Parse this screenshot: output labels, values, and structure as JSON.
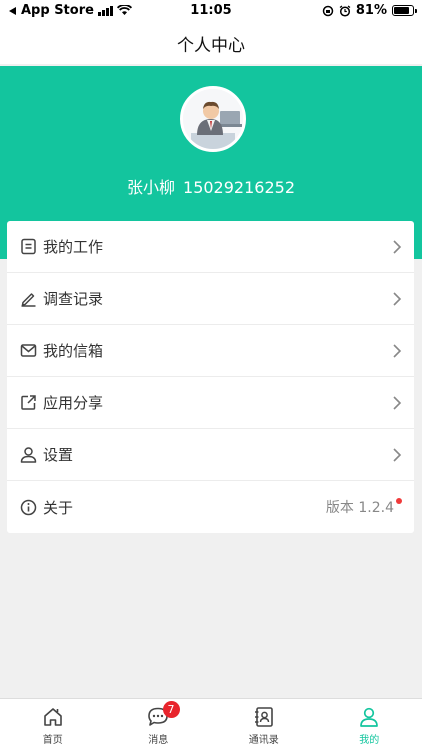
{
  "status_bar": {
    "carrier": "App Store",
    "time": "11:05",
    "battery": "81%",
    "battery_level": 0.81
  },
  "nav": {
    "title": "个人中心"
  },
  "header": {
    "user_name": "张小柳",
    "phone": "15029216252",
    "bg_color": "#13c59e"
  },
  "menu": {
    "items": [
      {
        "label": "我的工作",
        "icon": "document-icon"
      },
      {
        "label": "调查记录",
        "icon": "pencil-icon"
      },
      {
        "label": "我的信箱",
        "icon": "mail-icon"
      },
      {
        "label": "应用分享",
        "icon": "share-icon"
      },
      {
        "label": "设置",
        "icon": "user-icon"
      },
      {
        "label": "关于",
        "icon": "info-icon",
        "value": "版本 1.2.4"
      }
    ]
  },
  "tabs": [
    {
      "label": "首页",
      "icon": "home-icon"
    },
    {
      "label": "消息",
      "icon": "chat-icon",
      "badge": "7"
    },
    {
      "label": "通讯录",
      "icon": "contacts-icon"
    },
    {
      "label": "我的",
      "icon": "profile-icon",
      "active": true
    }
  ],
  "colors": {
    "accent": "#13c59e",
    "badge": "#e8242c"
  }
}
